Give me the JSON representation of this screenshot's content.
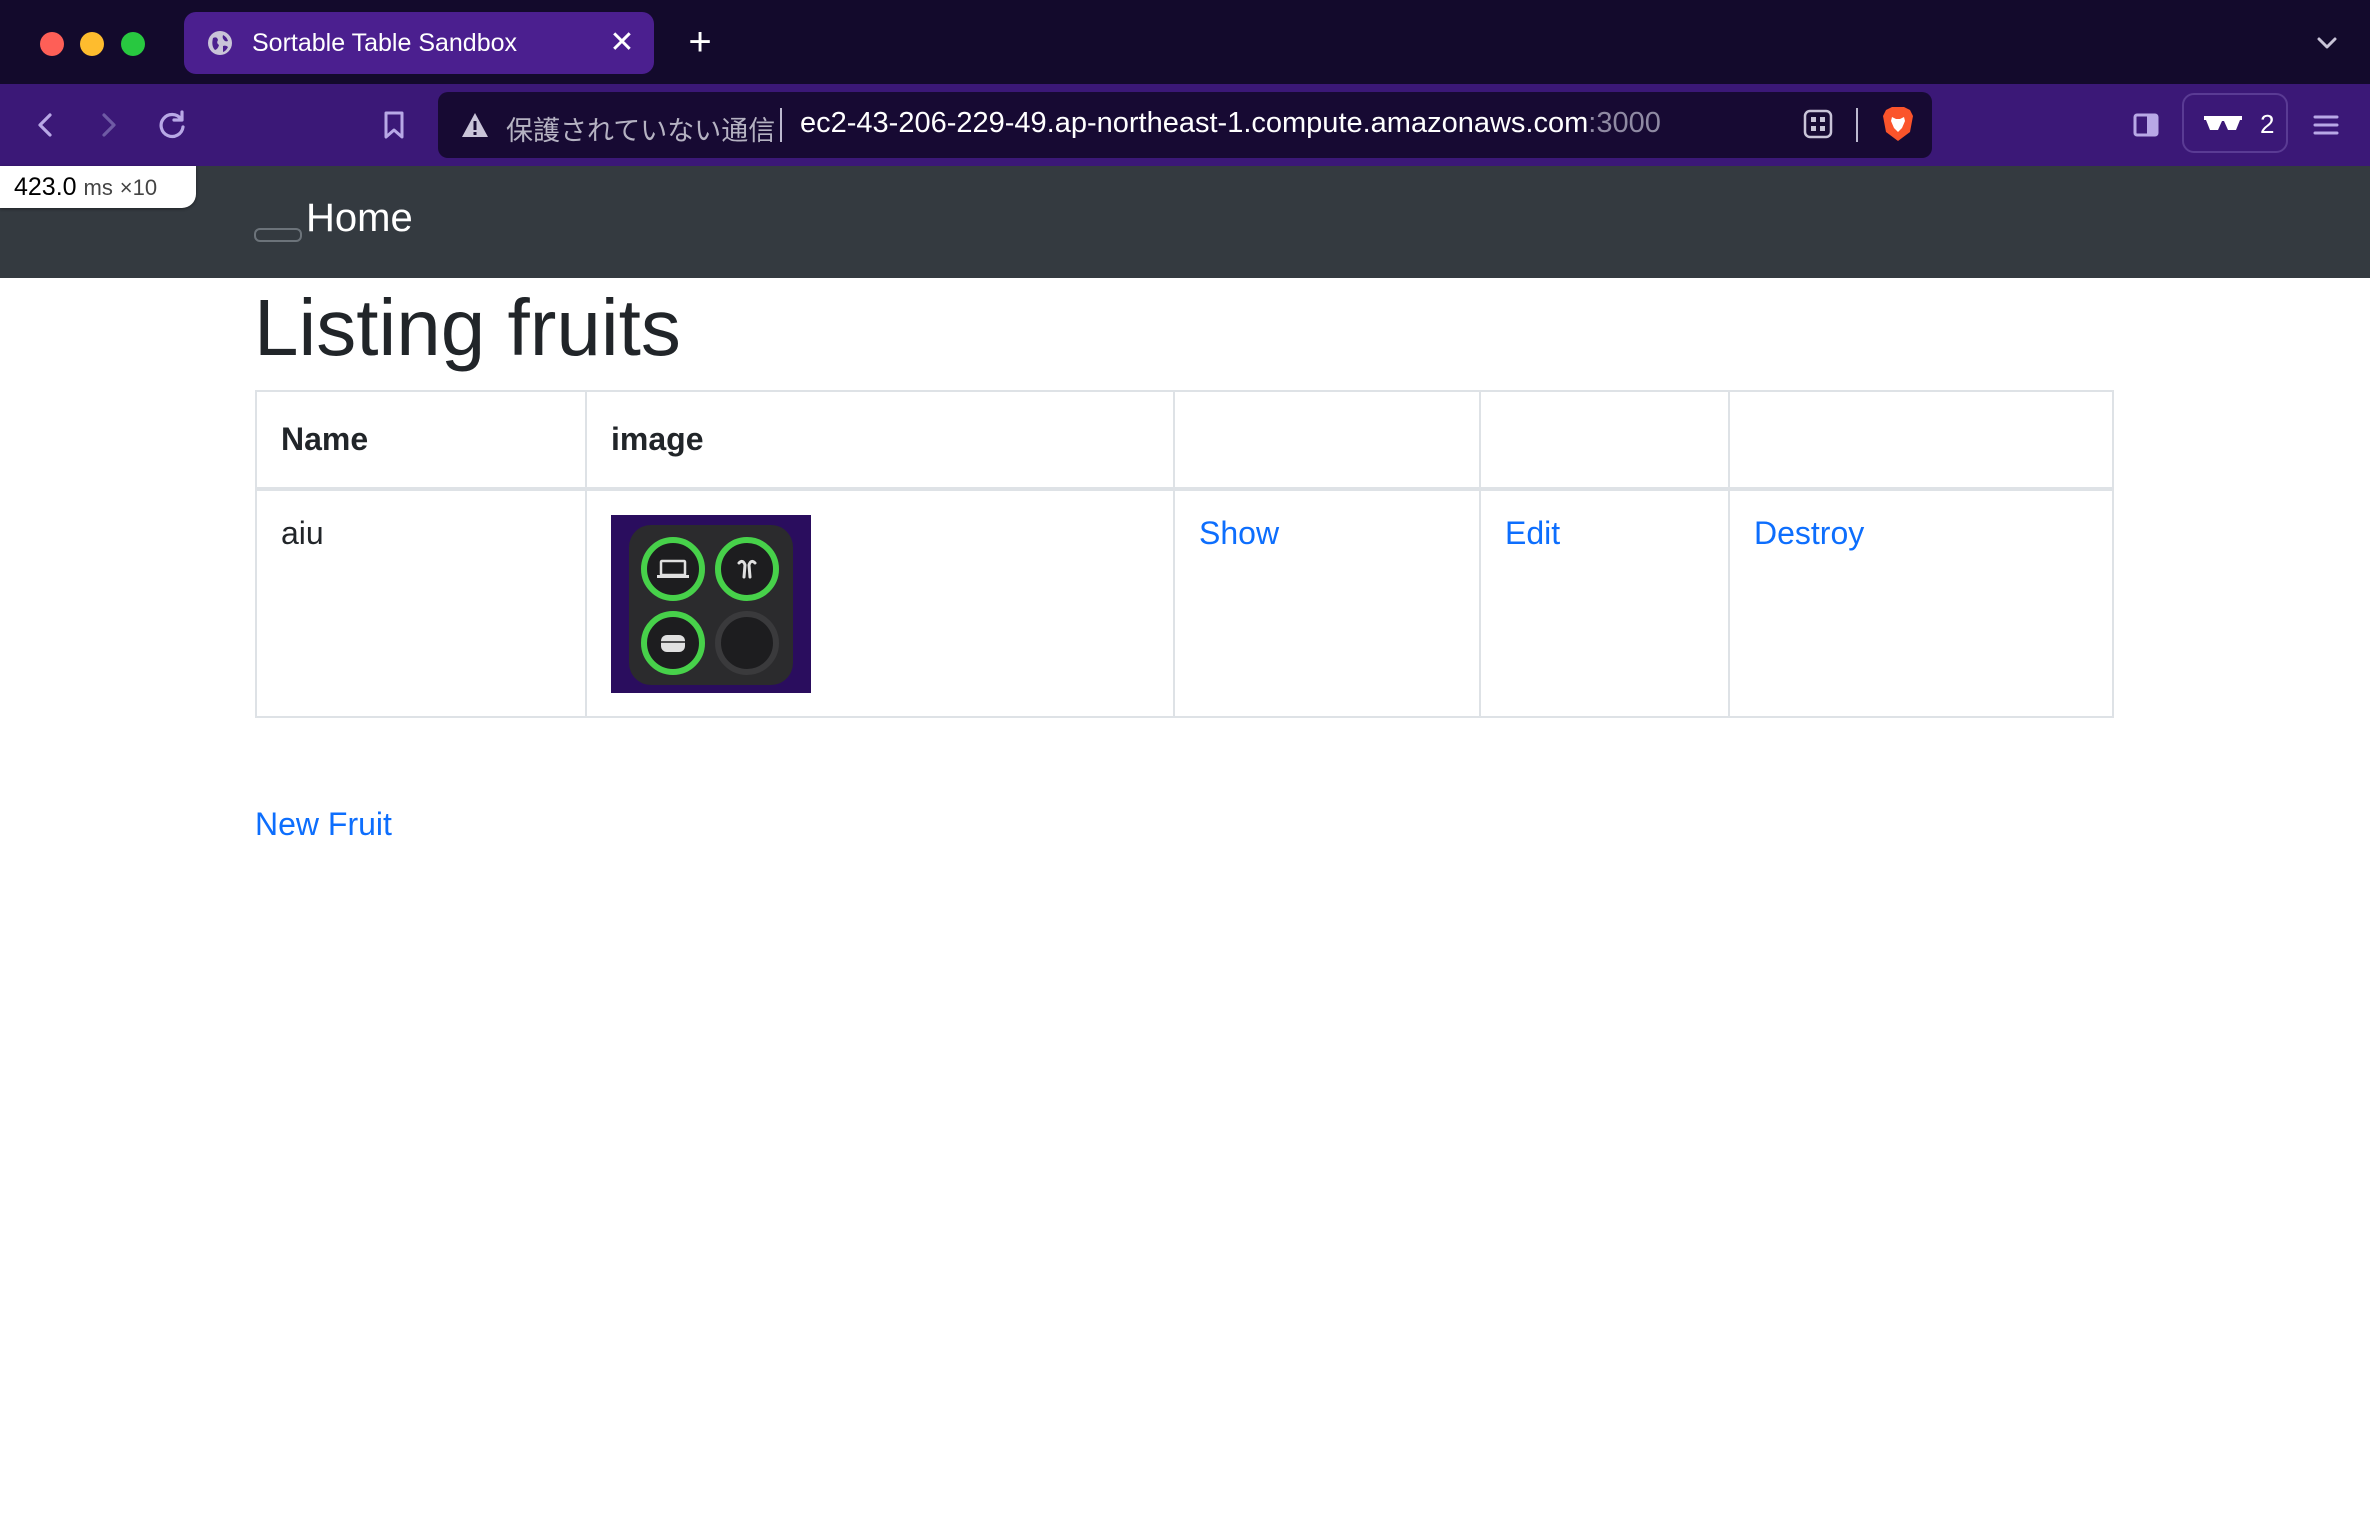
{
  "browser": {
    "tab_title": "Sortable Table Sandbox",
    "new_tab_icon": "plus-icon",
    "address": {
      "security_text": "保護されていない通信",
      "host": "ec2-43-206-229-49.ap-northeast-1.compute.amazonaws.com",
      "port": ":3000"
    },
    "wallet_count": "2",
    "accent_color": "#3b1877"
  },
  "perf_badge": {
    "value": "423.0",
    "unit": "ms",
    "multiplier": "×10"
  },
  "navbar": {
    "brand": "Home"
  },
  "page": {
    "title": "Listing fruits",
    "table": {
      "headers": [
        "Name",
        "image",
        "",
        "",
        ""
      ],
      "rows": [
        {
          "name": "aiu",
          "image": "battery-widget-thumbnail",
          "show": "Show",
          "edit": "Edit",
          "destroy": "Destroy"
        }
      ]
    },
    "new_link": "New Fruit",
    "link_color": "#0d6efd"
  }
}
